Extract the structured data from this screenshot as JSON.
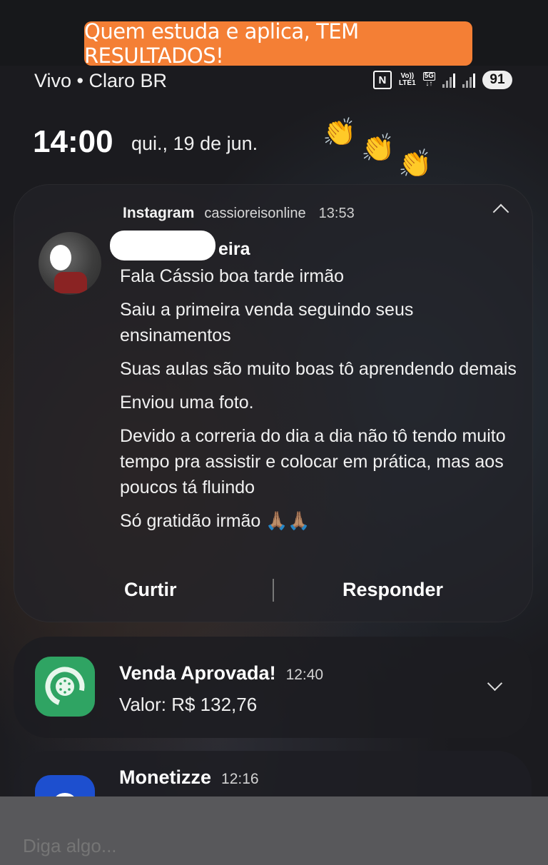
{
  "banner": {
    "text": "Quem estuda e aplica, TEM RESULTADOS!",
    "color": "#f47f35"
  },
  "status_bar": {
    "carrier": "Vivo • Claro BR",
    "nfc_label": "N",
    "volte_label": "Vo)) LTE1",
    "network": "5G",
    "battery": "91"
  },
  "lockscreen": {
    "time": "14:00",
    "date": "qui., 19 de jun.",
    "decoration": "👏"
  },
  "notification_instagram": {
    "app": "Instagram",
    "account": "cassioreisonline",
    "time": "13:53",
    "sender_visible": "eira",
    "messages": [
      "Fala Cássio boa tarde irmão",
      "Saiu a primeira venda seguindo seus ensinamentos",
      "Suas aulas são muito boas tô aprendendo demais",
      "Enviou uma foto.",
      "Devido a correria do dia a dia não tô tendo muito tempo pra assistir e colocar em prática, mas aos poucos tá fluindo",
      "Só gratidão irmão 🙏🏽🙏🏽"
    ],
    "actions": {
      "like": "Curtir",
      "reply": "Responder"
    }
  },
  "notification_sale": {
    "title": "Venda Aprovada!",
    "time": "12:40",
    "body": "Valor: R$ 132,76",
    "icon": "kiwify-icon",
    "icon_color": "#2fa463"
  },
  "notification_monetizze": {
    "title": "Monetizze",
    "time": "12:16",
    "icon": "monetizze-icon",
    "icon_color": "#1d4fcf"
  },
  "reply_bar": {
    "placeholder": "Diga algo..."
  }
}
